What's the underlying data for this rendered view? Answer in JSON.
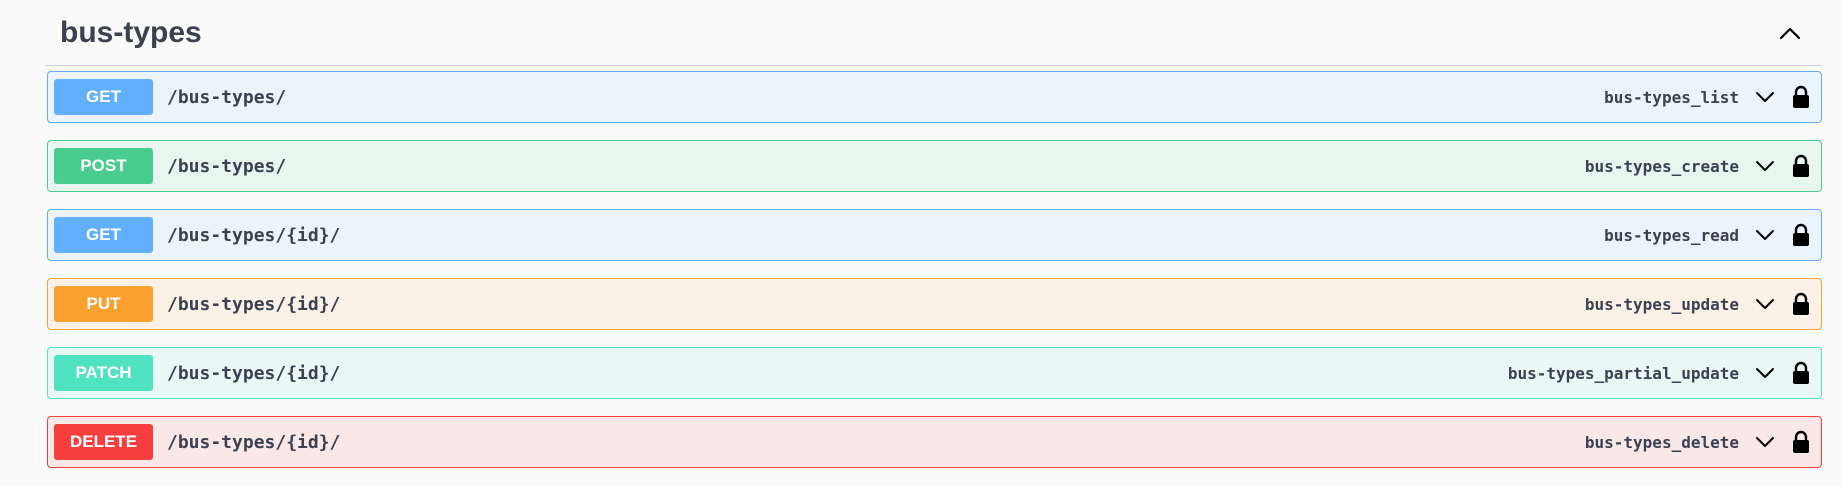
{
  "section": {
    "title": "bus-types"
  },
  "operations": [
    {
      "method": "GET",
      "path": "/bus-types/",
      "operation_id": "bus-types_list",
      "kind": "get"
    },
    {
      "method": "POST",
      "path": "/bus-types/",
      "operation_id": "bus-types_create",
      "kind": "post"
    },
    {
      "method": "GET",
      "path": "/bus-types/{id}/",
      "operation_id": "bus-types_read",
      "kind": "get"
    },
    {
      "method": "PUT",
      "path": "/bus-types/{id}/",
      "operation_id": "bus-types_update",
      "kind": "put"
    },
    {
      "method": "PATCH",
      "path": "/bus-types/{id}/",
      "operation_id": "bus-types_partial_update",
      "kind": "patch"
    },
    {
      "method": "DELETE",
      "path": "/bus-types/{id}/",
      "operation_id": "bus-types_delete",
      "kind": "delete"
    }
  ],
  "colors": {
    "get": "#61affe",
    "post": "#49cc90",
    "put": "#fca130",
    "patch": "#50e3c2",
    "delete": "#f93e3e",
    "text": "#3b4151"
  },
  "icons": {
    "collapse": "chevron-up-icon",
    "expand": "chevron-down-icon",
    "auth": "lock-icon"
  }
}
